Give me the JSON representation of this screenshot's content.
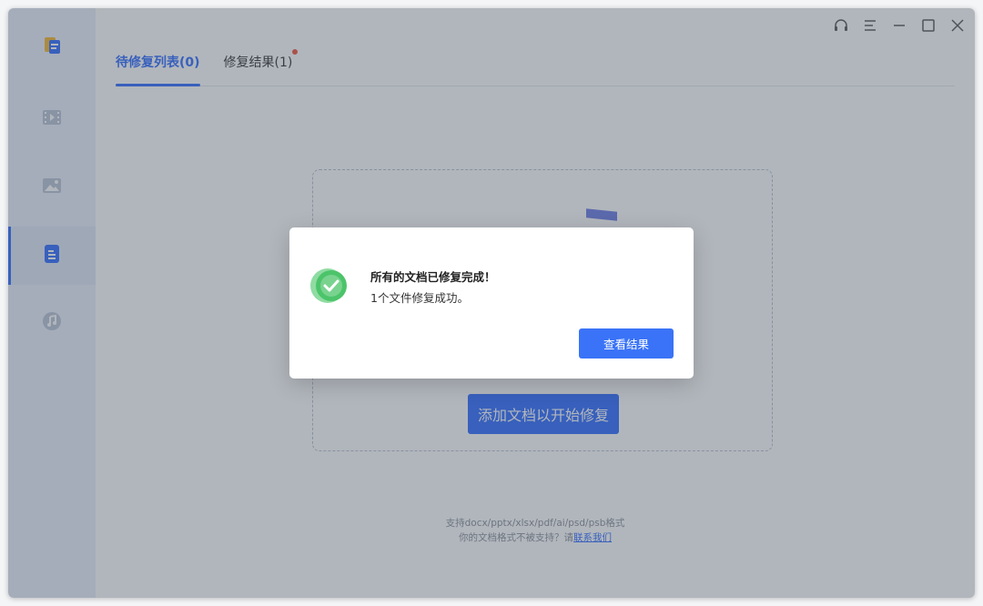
{
  "window": {
    "controls": [
      "headset-icon",
      "menu-icon",
      "minimize-icon",
      "maximize-icon",
      "close-icon"
    ]
  },
  "sidebar": {
    "items": [
      {
        "icon": "video-icon"
      },
      {
        "icon": "image-icon"
      },
      {
        "icon": "document-icon",
        "active": true
      },
      {
        "icon": "music-icon"
      }
    ]
  },
  "tabs": [
    {
      "label": "待修复列表(0)",
      "active": true
    },
    {
      "label": "修复结果(1)",
      "badge": true
    }
  ],
  "dropzone": {
    "add_button_label": "添加文档以开始修复"
  },
  "footnote": {
    "formats": "支持docx/pptx/xlsx/pdf/ai/psd/psb格式",
    "unsupported_prefix": "你的文档格式不被支持？请",
    "contact_link": "联系我们"
  },
  "dialog": {
    "title": "所有的文档已修复完成！",
    "message": "1个文件修复成功。",
    "button_label": "查看结果"
  },
  "colors": {
    "accent": "#2f6bff",
    "success": "#4cc46a",
    "badge": "#f2533b"
  }
}
